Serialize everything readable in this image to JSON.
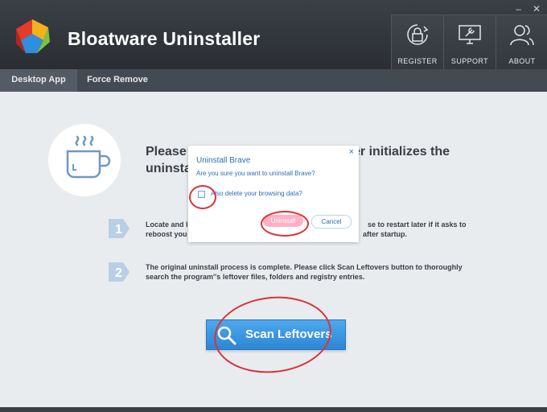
{
  "app": {
    "title": "Bloatware Uninstaller"
  },
  "window": {
    "minimize_glyph": "–",
    "close_glyph": "✕"
  },
  "header_buttons": [
    {
      "label": "REGISTER",
      "icon": "lock-refresh-icon"
    },
    {
      "label": "SUPPORT",
      "icon": "monitor-wrench-icon"
    },
    {
      "label": "ABOUT",
      "icon": "user-group-icon"
    }
  ],
  "tabs": [
    {
      "label": "Desktop App",
      "active": true
    },
    {
      "label": "Force Remove",
      "active": false
    }
  ],
  "main": {
    "heading_line1": "Please",
    "heading_line1_right": "staller initializes the",
    "heading_line2": "uninsta",
    "steps": [
      {
        "number": "1",
        "line1": "Locate and l",
        "line1_right": "se to restart later if it asks to",
        "line2": "reboost you",
        "line2_right": "after startup."
      },
      {
        "number": "2",
        "line1": "The original uninstall process is complete. Please click Scan Leftovers button to thoroughly",
        "line2": "search the program''s leftover files, folders and registry entries."
      }
    ],
    "scan_button": "Scan Leftovers"
  },
  "dialog": {
    "title": "Uninstall Brave",
    "close_glyph": "×",
    "question": "Are you sure you want to uninstall Brave?",
    "checkbox_label": "Also delete your browsing data?",
    "ok_label": "Uninstall",
    "cancel_label": "Cancel"
  },
  "colors": {
    "accent": "#31b5e8",
    "scan_button": "#3a93de",
    "annotation": "#d8343a",
    "dialog_text": "#2b6fb6"
  }
}
